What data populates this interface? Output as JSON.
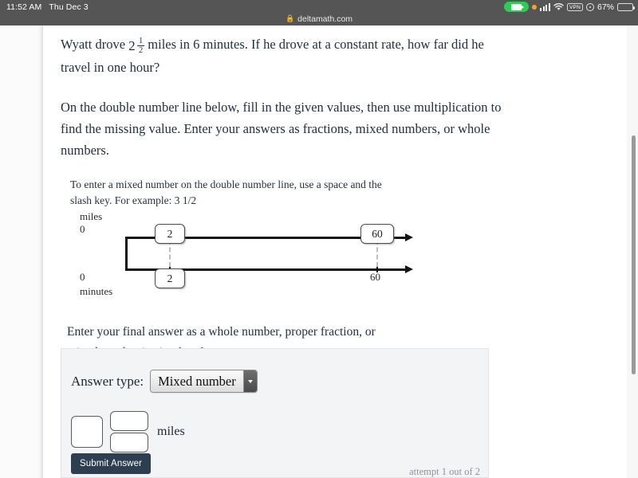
{
  "status_bar": {
    "time": "11:52 AM",
    "date": "Thu Dec 3",
    "vpn_label": "VPN",
    "battery_percent": "67%",
    "battery_level": 67,
    "recording_icon": "screen-recording-icon",
    "orange_dot_icon": "microphone-in-use-icon",
    "signal_icon": "cellular-signal-icon",
    "wifi_icon": "wifi-icon",
    "location_icon": "location-services-icon",
    "battery_icon": "battery-icon"
  },
  "browser": {
    "lock_icon": "lock-icon",
    "url": "deltamath.com"
  },
  "question": {
    "paragraph1_pre": "Wyatt drove ",
    "mixed_number": {
      "whole": "2",
      "numerator": "1",
      "denominator": "2"
    },
    "paragraph1_post": " miles in 6 minutes. If he drove at a constant rate, how far did he travel in one hour?",
    "paragraph2": "On the double number line below, fill in the given values, then use multiplication to find the missing value. Enter your answers as fractions, mixed numbers, or whole numbers.",
    "hint": "To enter a mixed number on the double number line, use a space and the slash key. For example: 3 1/2",
    "final_note": "Enter your final answer as a whole number, proper fraction, or mixed number in simplest form."
  },
  "number_line": {
    "top_label": "miles",
    "bottom_label": "minutes",
    "top_zero": "0",
    "bottom_zero": "0",
    "bottom_right_value": "60",
    "box_top_left": "2",
    "box_top_right": "60",
    "box_bottom_left": "2"
  },
  "answer_panel": {
    "answer_type_label": "Answer type:",
    "answer_type_value": "Mixed number",
    "answer_type_options": [
      "Mixed number"
    ],
    "dropdown_icon": "chevron-down-icon",
    "whole_value": "",
    "numerator_value": "",
    "denominator_value": "",
    "whole_placeholder": "",
    "numerator_placeholder": "",
    "denominator_placeholder": "",
    "unit": "miles",
    "submit_label": "Submit Answer",
    "attempt_text": "attempt 1 out of 2"
  },
  "colors": {
    "chrome": "#555555",
    "submit_button": "#2d3e50",
    "panel_background": "#f3f4f6",
    "recording_green": "#2fcc55",
    "text": "#22303f"
  }
}
